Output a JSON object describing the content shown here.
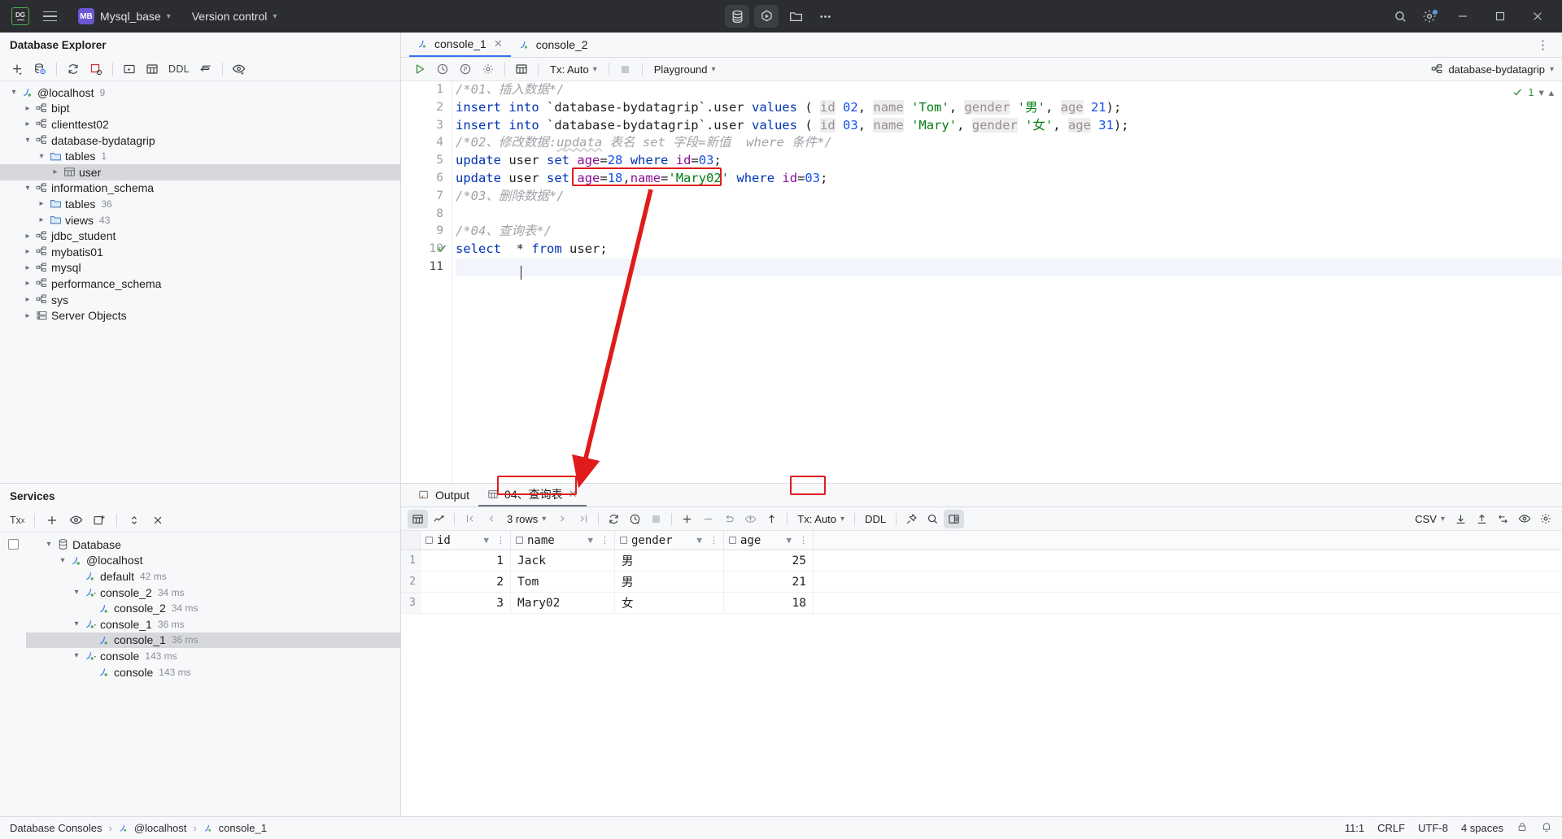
{
  "titlebar": {
    "logo": "datagrip-logo",
    "project_badge": "MB",
    "project_name": "Mysql_base",
    "vcs_label": "Version control",
    "center_buttons": [
      "database-icon",
      "run-icon",
      "folder-icon",
      "more-icon"
    ],
    "right_buttons": [
      "search-icon",
      "settings-icon"
    ],
    "window_buttons": [
      "minimize",
      "maximize",
      "close"
    ]
  },
  "db_explorer": {
    "title": "Database Explorer",
    "toolbar": [
      "add-icon",
      "data-source-properties-icon",
      "refresh-icon",
      "stop-icon",
      "open-console-icon",
      "table-editor-icon",
      "ddl-icon",
      "jump-to-editor-icon",
      "view-options-icon"
    ],
    "ddl_label": "DDL",
    "tree": [
      {
        "label": "@localhost",
        "count": "9",
        "depth": 0,
        "arrow": "down",
        "icon": "connection-icon",
        "selected": false
      },
      {
        "label": "bipt",
        "count": "",
        "depth": 1,
        "arrow": "right",
        "icon": "schema-icon",
        "selected": false
      },
      {
        "label": "clienttest02",
        "count": "",
        "depth": 1,
        "arrow": "right",
        "icon": "schema-icon",
        "selected": false
      },
      {
        "label": "database-bydatagrip",
        "count": "",
        "depth": 1,
        "arrow": "down",
        "icon": "schema-icon",
        "selected": false
      },
      {
        "label": "tables",
        "count": "1",
        "depth": 2,
        "arrow": "down",
        "icon": "folder-icon",
        "selected": false
      },
      {
        "label": "user",
        "count": "",
        "depth": 3,
        "arrow": "right",
        "icon": "table-icon",
        "selected": true
      },
      {
        "label": "information_schema",
        "count": "",
        "depth": 1,
        "arrow": "down",
        "icon": "schema-icon",
        "selected": false
      },
      {
        "label": "tables",
        "count": "36",
        "depth": 2,
        "arrow": "right",
        "icon": "folder-icon",
        "selected": false
      },
      {
        "label": "views",
        "count": "43",
        "depth": 2,
        "arrow": "right",
        "icon": "folder-icon",
        "selected": false
      },
      {
        "label": "jdbc_student",
        "count": "",
        "depth": 1,
        "arrow": "right",
        "icon": "schema-icon",
        "selected": false
      },
      {
        "label": "mybatis01",
        "count": "",
        "depth": 1,
        "arrow": "right",
        "icon": "schema-icon",
        "selected": false
      },
      {
        "label": "mysql",
        "count": "",
        "depth": 1,
        "arrow": "right",
        "icon": "schema-icon",
        "selected": false
      },
      {
        "label": "performance_schema",
        "count": "",
        "depth": 1,
        "arrow": "right",
        "icon": "schema-icon",
        "selected": false
      },
      {
        "label": "sys",
        "count": "",
        "depth": 1,
        "arrow": "right",
        "icon": "schema-icon",
        "selected": false
      },
      {
        "label": "Server Objects",
        "count": "",
        "depth": 1,
        "arrow": "right",
        "icon": "server-objects-icon",
        "selected": false
      }
    ]
  },
  "services": {
    "title": "Services",
    "tx_label": "Tx",
    "toolbar": [
      "tx-icon",
      "add-icon",
      "view-icon",
      "new-console-icon",
      "expand-collapse-icon",
      "close-icon"
    ],
    "tree": [
      {
        "label": "Database",
        "ms": "",
        "depth": 1,
        "arrow": "down",
        "icon": "database-group-icon",
        "selected": false
      },
      {
        "label": "@localhost",
        "ms": "",
        "depth": 2,
        "arrow": "down",
        "icon": "connection-icon",
        "selected": false
      },
      {
        "label": "default",
        "ms": "42 ms",
        "depth": 3,
        "arrow": "none",
        "icon": "console-leaf-icon",
        "selected": false
      },
      {
        "label": "console_2",
        "ms": "34 ms",
        "depth": 3,
        "arrow": "down",
        "icon": "session-icon",
        "selected": false
      },
      {
        "label": "console_2",
        "ms": "34 ms",
        "depth": 4,
        "arrow": "none",
        "icon": "console-leaf-icon",
        "selected": false
      },
      {
        "label": "console_1",
        "ms": "36 ms",
        "depth": 3,
        "arrow": "down",
        "icon": "session-icon",
        "selected": false
      },
      {
        "label": "console_1",
        "ms": "36 ms",
        "depth": 4,
        "arrow": "none",
        "icon": "console-leaf-icon",
        "selected": true
      },
      {
        "label": "console",
        "ms": "143 ms",
        "depth": 3,
        "arrow": "down",
        "icon": "session-icon",
        "selected": false
      },
      {
        "label": "console",
        "ms": "143 ms",
        "depth": 4,
        "arrow": "none",
        "icon": "console-leaf-icon",
        "selected": false
      }
    ]
  },
  "editor": {
    "tabs": [
      {
        "label": "console_1",
        "active": true,
        "icon": "console-icon"
      },
      {
        "label": "console_2",
        "active": false,
        "icon": "console-icon"
      }
    ],
    "toolbar": {
      "run": "run-icon",
      "history": "history-icon",
      "explain": "explain-plan-icon",
      "settings": "settings-icon",
      "grid": "table-icon",
      "tx_label": "Tx: Auto",
      "stop": "stop-icon",
      "schema_label": "Playground",
      "datasource_label": "database-bydatagrip"
    },
    "inspection": {
      "count": "1",
      "status": "ok"
    },
    "lines": [
      {
        "n": 1,
        "marker": "",
        "current": false
      },
      {
        "n": 2,
        "marker": "",
        "current": false
      },
      {
        "n": 3,
        "marker": "",
        "current": false
      },
      {
        "n": 4,
        "marker": "",
        "current": false
      },
      {
        "n": 5,
        "marker": "",
        "current": false
      },
      {
        "n": 6,
        "marker": "",
        "current": false
      },
      {
        "n": 7,
        "marker": "",
        "current": false
      },
      {
        "n": 8,
        "marker": "",
        "current": false
      },
      {
        "n": 9,
        "marker": "",
        "current": false
      },
      {
        "n": 10,
        "marker": "check",
        "current": false
      },
      {
        "n": 11,
        "marker": "",
        "current": true
      }
    ],
    "code_text": [
      "/*01、插入数据*/",
      "insert into `database-bydatagrip`.user values ( id 02, name 'Tom', gender '男', age 21);",
      "insert into `database-bydatagrip`.user values ( id 03, name 'Mary', gender '女', age 31);",
      "/*02、修改数据:updata 表名 set 字段=新值  where 条件*/",
      "update user set age=28 where id=03;",
      "update user set age=18,name='Mary02' where id=03;",
      "/*03、删除数据*/",
      "",
      "/*04、查询表*/",
      "select  * from user;",
      ""
    ]
  },
  "results": {
    "tabs": [
      {
        "label": "Output",
        "active": false,
        "icon": "output-icon",
        "closable": false
      },
      {
        "label": "04、查询表",
        "active": true,
        "icon": "table-icon",
        "closable": true
      }
    ],
    "toolbar": {
      "grid_view": "grid-view-icon",
      "chart_view": "chart-view-icon",
      "first_page": "first-page-icon",
      "prev_page": "prev-page-icon",
      "rows_label": "3 rows",
      "next_page": "next-page-icon",
      "last_page": "last-page-icon",
      "reload": "reload-icon",
      "page_timing": "timing-icon",
      "stop": "stop-icon",
      "add_row": "add-row-icon",
      "delete_row": "delete-row-icon",
      "revert": "revert-icon",
      "commit": "commit-icon",
      "rollback": "rollback-icon",
      "tx_label": "Tx: Auto",
      "ddl_label": "DDL",
      "pin": "pin-icon",
      "find": "search-icon",
      "wide": "value-editor-icon",
      "export_format": "CSV",
      "download": "download-icon",
      "upload": "upload-icon",
      "compare": "compare-icon",
      "preview": "preview-icon",
      "settings": "settings-icon"
    },
    "columns": [
      "id",
      "name",
      "gender",
      "age"
    ],
    "rows": [
      {
        "n": "1",
        "id": "1",
        "name": "Jack",
        "gender": "男",
        "age": "25"
      },
      {
        "n": "2",
        "id": "2",
        "name": "Tom",
        "gender": "男",
        "age": "21"
      },
      {
        "n": "3",
        "id": "3",
        "name": "Mary02",
        "gender": "女",
        "age": "18"
      }
    ]
  },
  "annotations": {
    "color": "#e01b1b",
    "highlight_code": "age=18,name='Mary02'",
    "highlight_cells": [
      "Mary02",
      "18"
    ]
  },
  "statusbar": {
    "breadcrumb": [
      "Database Consoles",
      "@localhost",
      "console_1"
    ],
    "caret": "11:1",
    "line_sep": "CRLF",
    "encoding": "UTF-8",
    "indent": "4 spaces",
    "icons": [
      "lock-icon",
      "notifications-icon"
    ]
  }
}
